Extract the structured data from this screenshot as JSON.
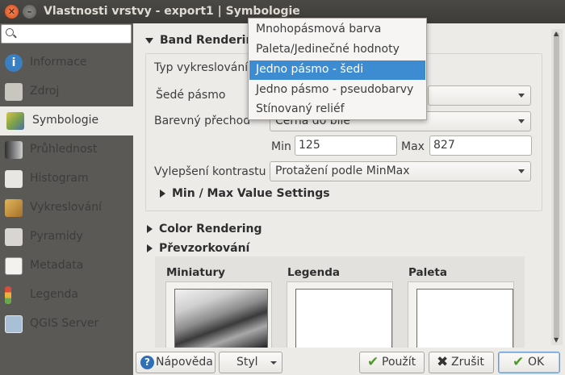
{
  "window": {
    "title": "Vlastnosti vrstvy - export1 | Symbologie"
  },
  "sidebar": {
    "search_placeholder": "",
    "items": [
      {
        "label": "Informace"
      },
      {
        "label": "Zdroj"
      },
      {
        "label": "Symbologie"
      },
      {
        "label": "Průhlednost"
      },
      {
        "label": "Histogram"
      },
      {
        "label": "Vykreslování"
      },
      {
        "label": "Pyramidy"
      },
      {
        "label": "Metadata"
      },
      {
        "label": "Legenda"
      },
      {
        "label": "QGIS Server"
      }
    ],
    "active_index": 2
  },
  "band_rendering": {
    "header": "Band Rendering",
    "render_type_label": "Typ vykreslování",
    "gray_band_label": "Šedé pásmo",
    "color_gradient_label": "Barevný přechod",
    "color_gradient_value": "Černá do bílé",
    "min_label": "Min",
    "min_value": "125",
    "max_label": "Max",
    "max_value": "827",
    "contrast_label": "Vylepšení kontrastu",
    "contrast_value": "Protažení podle MinMax",
    "minmax_settings": "Min / Max Value Settings"
  },
  "sections": {
    "color_rendering": "Color Rendering",
    "resampling": "Převzorkování"
  },
  "previews": {
    "thumbnails": "Miniatury",
    "legend": "Legenda",
    "palette": "Paleta"
  },
  "render_type_dropdown": {
    "options": [
      "Mnohopásmová barva",
      "Paleta/Jedinečné hodnoty",
      "Jedno pásmo - šedi",
      "Jedno pásmo - pseudobarvy",
      "Stínovaný reliéf"
    ],
    "selected": "Jedno pásmo - šedi"
  },
  "buttons": {
    "help": "Nápověda",
    "style": "Styl",
    "apply": "Použít",
    "cancel": "Zrušit",
    "ok": "OK"
  },
  "colors": {
    "sidebar_bg": "#5b5955",
    "selection": "#3d8bd0",
    "titlebar": "#3d3c38"
  }
}
